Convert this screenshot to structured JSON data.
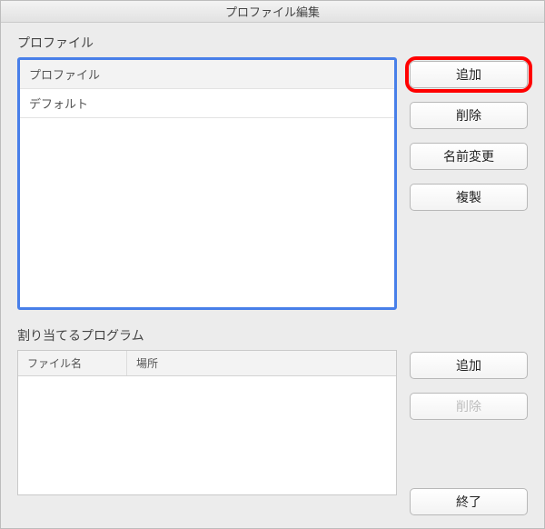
{
  "title": "プロファイル編集",
  "profileSection": {
    "label": "プロファイル",
    "items": [
      "プロファイル",
      "デフォルト"
    ],
    "buttons": {
      "add": "追加",
      "delete": "削除",
      "rename": "名前変更",
      "duplicate": "複製"
    }
  },
  "programSection": {
    "label": "割り当てるプログラム",
    "columns": {
      "filename": "ファイル名",
      "location": "場所"
    },
    "buttons": {
      "add": "追加",
      "delete": "削除",
      "exit": "終了"
    }
  }
}
